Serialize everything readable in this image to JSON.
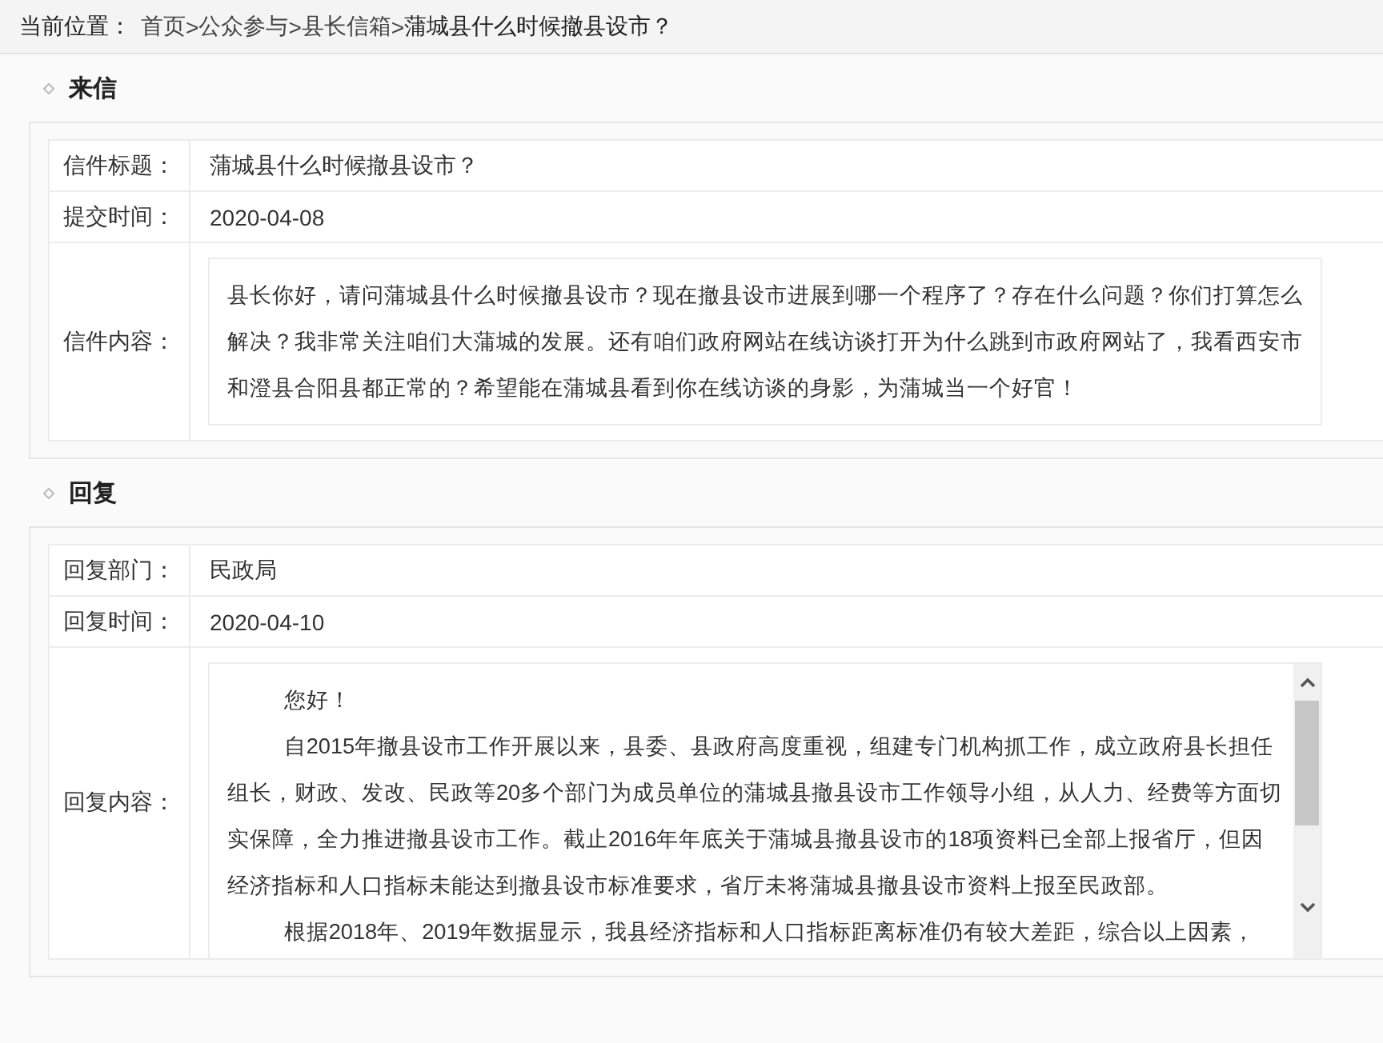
{
  "breadcrumb": {
    "label": "当前位置：",
    "items": [
      {
        "kind": "link",
        "text": "首页"
      },
      {
        "kind": "separator",
        "text": ">"
      },
      {
        "kind": "link",
        "text": "公众参与"
      },
      {
        "kind": "separator",
        "text": ">"
      },
      {
        "kind": "link",
        "text": "县长信箱"
      },
      {
        "kind": "separator",
        "text": ">"
      },
      {
        "kind": "current",
        "text": "蒲城县什么时候撤县设市？"
      }
    ]
  },
  "sections": [
    {
      "title": "来信",
      "fields": [
        {
          "kind": "line",
          "label": "信件标题：",
          "value": "蒲城县什么时候撤县设市？"
        },
        {
          "kind": "line",
          "label": "提交时间：",
          "value": "2020-04-08"
        },
        {
          "kind": "box",
          "label": "信件内容：",
          "paragraphs": [
            "县长你好，请问蒲城县什么时候撤县设市？现在撤县设市进展到哪一个程序了？存在什么问题？你们打算怎么解决？我非常关注咱们大蒲城的发展。还有咱们政府网站在线访谈打开为什么跳到市政府网站了，我看西安市和澄县合阳县都正常的？希望能在蒲城县看到你在线访谈的身影，为蒲城当一个好官！"
          ]
        }
      ]
    },
    {
      "title": "回复",
      "fields": [
        {
          "kind": "line",
          "label": "回复部门：",
          "value": "民政局"
        },
        {
          "kind": "line",
          "label": "回复时间：",
          "value": "2020-04-10"
        },
        {
          "kind": "scrollbox",
          "label": "回复内容：",
          "paragraphs": [
            "您好！",
            "自2015年撤县设市工作开展以来，县委、县政府高度重视，组建专门机构抓工作，成立政府县长担任组长，财政、发改、民政等20多个部门为成员单位的蒲城县撤县设市工作领导小组，从人力、经费等方面切实保障，全力推进撤县设市工作。截止2016年年底关于蒲城县撤县设市的18项资料已全部上报省厅，但因经济指标和人口指标未能达到撤县设市标准要求，省厅未将蒲城县撤县设市资料上报至民政部。",
            "根据2018年、2019年数据显示，我县经济指标和人口指标距离标准仍有较大差距，综合以上因素，"
          ]
        }
      ]
    }
  ]
}
